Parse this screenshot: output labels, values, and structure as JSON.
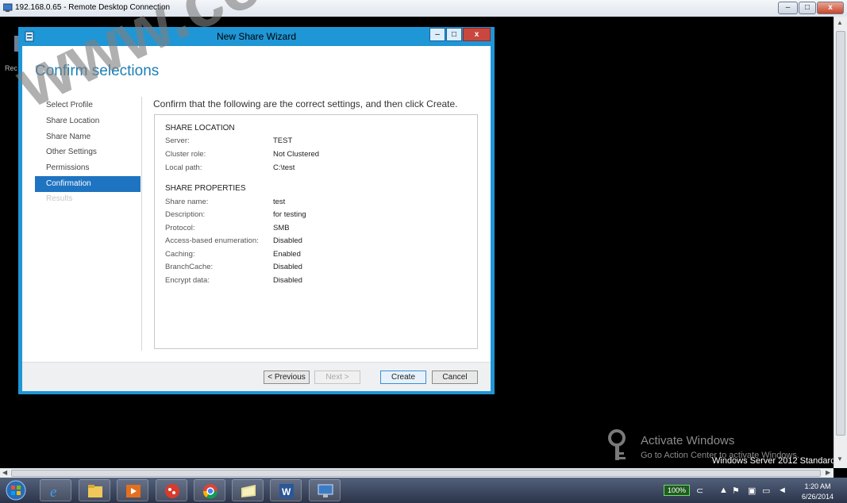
{
  "outer_window": {
    "title": "192.168.0.65 - Remote Desktop Connection",
    "controls": {
      "minimize": "–",
      "maximize": "□",
      "close": "x"
    }
  },
  "remote_desktop": {
    "recycle_label": "Rec"
  },
  "wizard": {
    "title": "New Share Wizard",
    "controls": {
      "minimize": "–",
      "maximize": "□",
      "close": "x"
    },
    "heading": "Confirm selections",
    "nav": [
      {
        "label": "Select Profile",
        "state": "normal"
      },
      {
        "label": "Share Location",
        "state": "normal"
      },
      {
        "label": "Share Name",
        "state": "normal"
      },
      {
        "label": "Other Settings",
        "state": "normal"
      },
      {
        "label": "Permissions",
        "state": "normal"
      },
      {
        "label": "Confirmation",
        "state": "active"
      },
      {
        "label": "Results",
        "state": "disabled"
      }
    ],
    "instruction": "Confirm that the following are the correct settings, and then click Create.",
    "share_location": {
      "title": "SHARE LOCATION",
      "rows": [
        {
          "label": "Server:",
          "value": "TEST"
        },
        {
          "label": "Cluster role:",
          "value": "Not Clustered"
        },
        {
          "label": "Local path:",
          "value": "C:\\test"
        }
      ]
    },
    "share_properties": {
      "title": "SHARE PROPERTIES",
      "rows": [
        {
          "label": "Share name:",
          "value": "test"
        },
        {
          "label": "Description:",
          "value": "for testing"
        },
        {
          "label": "Protocol:",
          "value": "SMB"
        },
        {
          "label": "Access-based enumeration:",
          "value": "Disabled"
        },
        {
          "label": "Caching:",
          "value": "Enabled"
        },
        {
          "label": "BranchCache:",
          "value": "Disabled"
        },
        {
          "label": "Encrypt data:",
          "value": "Disabled"
        }
      ]
    },
    "buttons": {
      "previous": "< Previous",
      "next": "Next >",
      "create": "Create",
      "cancel": "Cancel"
    }
  },
  "activation": {
    "title": "Activate Windows",
    "subtitle": "Go to Action Center to activate Windows.",
    "edition": "Windows Server 2012 Standard"
  },
  "watermark": "www.certiology.com",
  "taskbar": {
    "apps": [
      "internet-explorer-icon",
      "file-explorer-icon",
      "media-player-icon",
      "paint-icon",
      "chrome-icon",
      "folder-icon",
      "word-icon",
      "remote-desktop-icon"
    ],
    "battery": "100%",
    "time": "1:20 AM",
    "date": "6/26/2014"
  },
  "colors": {
    "wizard_frame": "#1f96d6",
    "heading": "#1a7fb5",
    "nav_active": "#1f74c1"
  }
}
